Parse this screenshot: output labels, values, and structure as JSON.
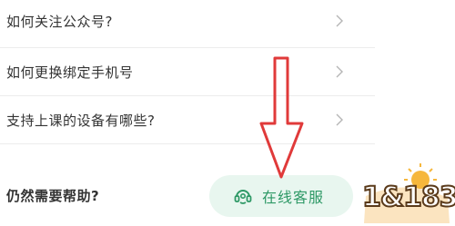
{
  "faq": {
    "items": [
      {
        "label": "如何关注公众号?"
      },
      {
        "label": "如何更换绑定手机号"
      },
      {
        "label": "支持上课的设备有哪些?"
      }
    ]
  },
  "help": {
    "title": "仍然需要帮助?"
  },
  "support_button": {
    "label": "在线客服",
    "icon": "headset-icon",
    "color": "#2e9966",
    "background": "#e8f6ef"
  },
  "annotation": {
    "icon": "red-arrow-down",
    "color": "#e03a3a"
  },
  "watermark": {
    "text": "1&183"
  }
}
